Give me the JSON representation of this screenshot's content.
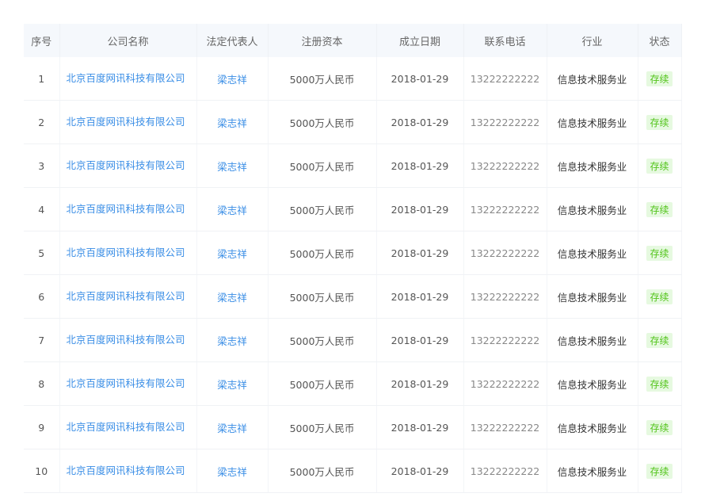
{
  "columns": [
    "序号",
    "公司名称",
    "法定代表人",
    "注册资本",
    "成立日期",
    "联系电话",
    "行业",
    "状态"
  ],
  "rows": [
    {
      "no": "1",
      "company": "北京百度网讯科技有限公司",
      "legal_rep": "梁志祥",
      "capital": "5000万人民币",
      "date": "2018-01-29",
      "phone": "13222222222",
      "industry": "信息技术服务业",
      "status": "存续"
    },
    {
      "no": "2",
      "company": "北京百度网讯科技有限公司",
      "legal_rep": "梁志祥",
      "capital": "5000万人民币",
      "date": "2018-01-29",
      "phone": "13222222222",
      "industry": "信息技术服务业",
      "status": "存续"
    },
    {
      "no": "3",
      "company": "北京百度网讯科技有限公司",
      "legal_rep": "梁志祥",
      "capital": "5000万人民币",
      "date": "2018-01-29",
      "phone": "13222222222",
      "industry": "信息技术服务业",
      "status": "存续"
    },
    {
      "no": "4",
      "company": "北京百度网讯科技有限公司",
      "legal_rep": "梁志祥",
      "capital": "5000万人民币",
      "date": "2018-01-29",
      "phone": "13222222222",
      "industry": "信息技术服务业",
      "status": "存续"
    },
    {
      "no": "5",
      "company": "北京百度网讯科技有限公司",
      "legal_rep": "梁志祥",
      "capital": "5000万人民币",
      "date": "2018-01-29",
      "phone": "13222222222",
      "industry": "信息技术服务业",
      "status": "存续"
    },
    {
      "no": "6",
      "company": "北京百度网讯科技有限公司",
      "legal_rep": "梁志祥",
      "capital": "5000万人民币",
      "date": "2018-01-29",
      "phone": "13222222222",
      "industry": "信息技术服务业",
      "status": "存续"
    },
    {
      "no": "7",
      "company": "北京百度网讯科技有限公司",
      "legal_rep": "梁志祥",
      "capital": "5000万人民币",
      "date": "2018-01-29",
      "phone": "13222222222",
      "industry": "信息技术服务业",
      "status": "存续"
    },
    {
      "no": "8",
      "company": "北京百度网讯科技有限公司",
      "legal_rep": "梁志祥",
      "capital": "5000万人民币",
      "date": "2018-01-29",
      "phone": "13222222222",
      "industry": "信息技术服务业",
      "status": "存续"
    },
    {
      "no": "9",
      "company": "北京百度网讯科技有限公司",
      "legal_rep": "梁志祥",
      "capital": "5000万人民币",
      "date": "2018-01-29",
      "phone": "13222222222",
      "industry": "信息技术服务业",
      "status": "存续"
    },
    {
      "no": "10",
      "company": "北京百度网讯科技有限公司",
      "legal_rep": "梁志祥",
      "capital": "5000万人民币",
      "date": "2018-01-29",
      "phone": "13222222222",
      "industry": "信息技术服务业",
      "status": "存续"
    }
  ]
}
